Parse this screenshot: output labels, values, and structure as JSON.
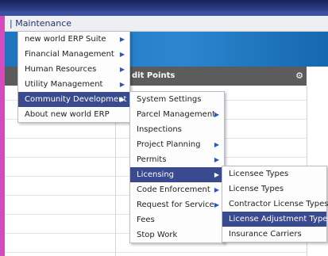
{
  "header": {
    "breadcrumb": "| Maintenance"
  },
  "panel": {
    "title": "dit Points",
    "settings_icon": "gear-icon"
  },
  "menu_main": [
    {
      "label": "new world ERP Suite",
      "arrow": "▶"
    },
    {
      "label": "Financial Management",
      "arrow": "▶"
    },
    {
      "label": "Human Resources",
      "arrow": "▶"
    },
    {
      "label": "Utility Management",
      "arrow": "▶"
    },
    {
      "label": "Community Development",
      "arrow": "▶"
    },
    {
      "label": "About new world ERP",
      "arrow": ""
    }
  ],
  "menu_community": [
    {
      "label": "System Settings",
      "arrow": ""
    },
    {
      "label": "Parcel Management",
      "arrow": "▶"
    },
    {
      "label": "Inspections",
      "arrow": ""
    },
    {
      "label": "Project Planning",
      "arrow": "▶"
    },
    {
      "label": "Permits",
      "arrow": "▶"
    },
    {
      "label": "Licensing",
      "arrow": "▶"
    },
    {
      "label": "Code Enforcement",
      "arrow": "▶"
    },
    {
      "label": "Request for Service",
      "arrow": "▶"
    },
    {
      "label": "Fees",
      "arrow": ""
    },
    {
      "label": "Stop Work",
      "arrow": ""
    }
  ],
  "menu_licensing": [
    {
      "label": "Licensee Types"
    },
    {
      "label": "License Types"
    },
    {
      "label": "Contractor License Types"
    },
    {
      "label": "License Adjustment Types"
    },
    {
      "label": "Insurance Carriers"
    }
  ],
  "colors": {
    "accent": "#3a4a8f",
    "band": "#2b86cf",
    "left_strip": "#d44bbd"
  }
}
